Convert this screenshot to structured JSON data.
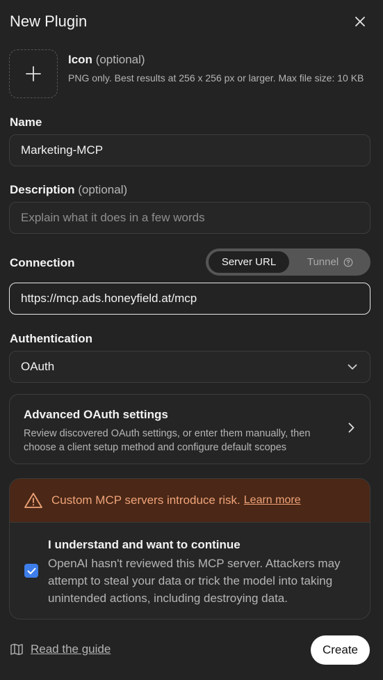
{
  "header": {
    "title": "New Plugin",
    "close_icon": "close-icon"
  },
  "icon_upload": {
    "title": "Icon",
    "optional": "(optional)",
    "description": "PNG only. Best results at 256 x 256 px or larger. Max file size: 10 KB",
    "icon": "plus-icon"
  },
  "name": {
    "label": "Name",
    "value": "Marketing-MCP"
  },
  "description": {
    "label": "Description",
    "optional": "(optional)",
    "placeholder": "Explain what it does in a few words"
  },
  "connection": {
    "label": "Connection",
    "segments": {
      "active": "Server URL",
      "inactive": "Tunnel"
    },
    "value": "https://mcp.ads.honeyfield.at/mcp"
  },
  "authentication": {
    "label": "Authentication",
    "value": "OAuth"
  },
  "advanced": {
    "title": "Advanced OAuth settings",
    "description": "Review discovered OAuth settings, or enter them manually, then choose a client setup method and configure default scopes"
  },
  "risk": {
    "warning": "Custom MCP servers introduce risk.",
    "link": "Learn more",
    "ack_title": "I understand and want to continue",
    "ack_desc": "OpenAI hasn't reviewed this MCP server. Attackers may attempt to steal your data or trick the model into taking unintended actions, including destroying data.",
    "checked": true
  },
  "footer": {
    "guide": "Read the guide",
    "create": "Create"
  },
  "colors": {
    "background": "#232323",
    "accent": "#3d7eea",
    "warning_bg": "#4a2716",
    "warning_text": "#f0a47a"
  }
}
